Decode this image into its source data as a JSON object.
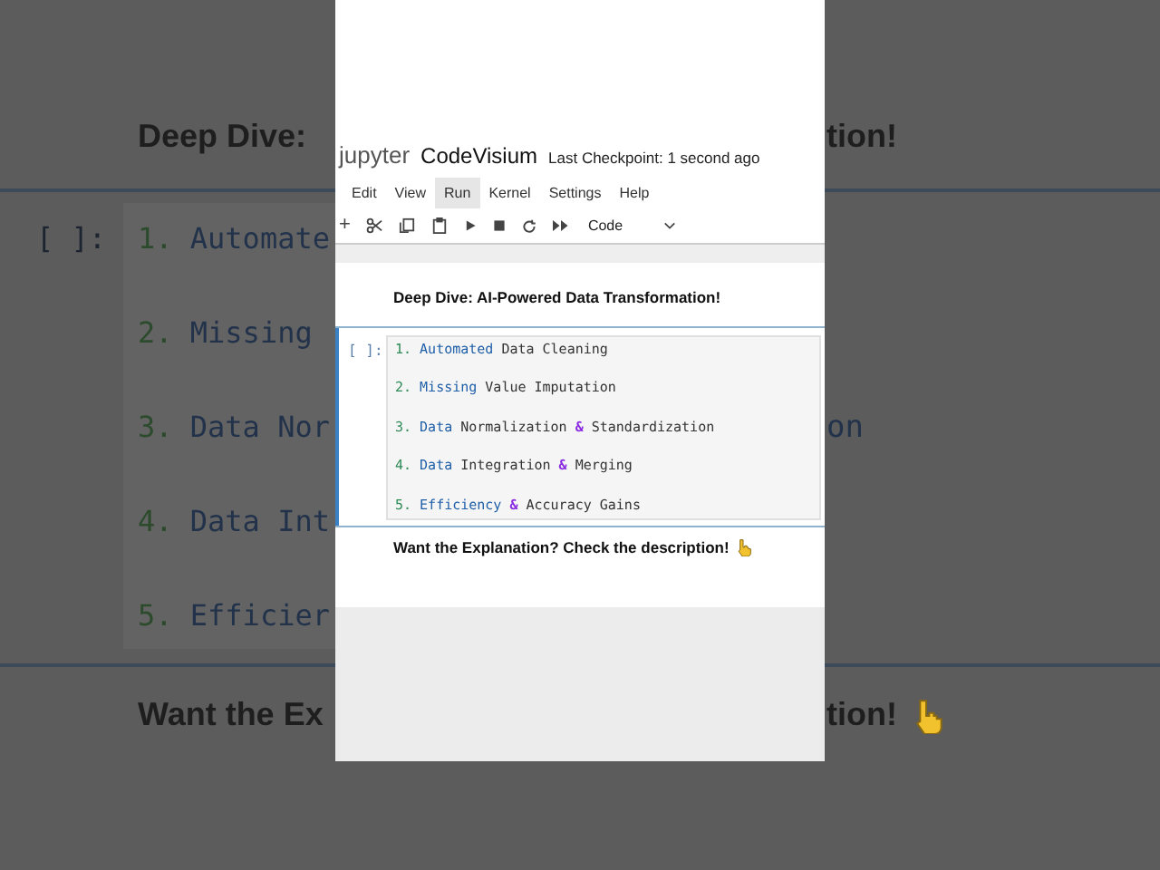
{
  "backdrop": {
    "left": [
      {
        "kind": "heading",
        "text": "Deep Dive: "
      },
      {
        "kind": "prompt",
        "text": "[ ]:"
      },
      {
        "kind": "code",
        "number": "1.",
        "text": "Automate"
      },
      {
        "kind": "code",
        "number": "2.",
        "text": "Missing"
      },
      {
        "kind": "code",
        "number": "3.",
        "text": "Data Nor"
      },
      {
        "kind": "code",
        "number": "4.",
        "text": "Data Int"
      },
      {
        "kind": "code",
        "number": "5.",
        "text": "Efficier"
      },
      {
        "kind": "footer",
        "text": "Want the Ex"
      }
    ],
    "right": [
      {
        "kind": "heading",
        "text": "tion!"
      },
      {
        "kind": "code",
        "text": "on"
      },
      {
        "kind": "footer",
        "text": "tion!"
      }
    ]
  },
  "header": {
    "logo": "jupyter",
    "notebook_name": "CodeVisium",
    "checkpoint": "Last Checkpoint: 1 second ago"
  },
  "menu": [
    {
      "label": "Edit",
      "selected": false
    },
    {
      "label": "View",
      "selected": false
    },
    {
      "label": "Run",
      "selected": true
    },
    {
      "label": "Kernel",
      "selected": false
    },
    {
      "label": "Settings",
      "selected": false
    },
    {
      "label": "Help",
      "selected": false
    }
  ],
  "toolbar": {
    "add": "+",
    "cell_type": "Code"
  },
  "cells": [
    {
      "kind": "markdown",
      "text": "Deep Dive: AI-Powered Data Transformation!"
    },
    {
      "kind": "code",
      "prompt": "[ ]:",
      "lines": [
        [
          {
            "kind": "number",
            "text": "1."
          },
          {
            "kind": "name",
            "text": "Automated"
          },
          {
            "kind": "text",
            "text": "Data Cleaning"
          }
        ],
        [
          {
            "kind": "number",
            "text": "2."
          },
          {
            "kind": "name",
            "text": "Missing"
          },
          {
            "kind": "text",
            "text": "Value Imputation"
          }
        ],
        [
          {
            "kind": "number",
            "text": "3."
          },
          {
            "kind": "name",
            "text": "Data"
          },
          {
            "kind": "text",
            "text": "Normalization"
          },
          {
            "kind": "operator",
            "text": "&"
          },
          {
            "kind": "text",
            "text": "Standardization"
          }
        ],
        [
          {
            "kind": "number",
            "text": "4."
          },
          {
            "kind": "name",
            "text": "Data"
          },
          {
            "kind": "text",
            "text": "Integration"
          },
          {
            "kind": "operator",
            "text": "&"
          },
          {
            "kind": "text",
            "text": "Merging"
          }
        ],
        [
          {
            "kind": "number",
            "text": "5."
          },
          {
            "kind": "name",
            "text": "Efficiency"
          },
          {
            "kind": "operator",
            "text": "&"
          },
          {
            "kind": "text",
            "text": "Accuracy Gains"
          }
        ]
      ]
    },
    {
      "kind": "markdown_footer",
      "text": "Want the Explanation? Check the description!"
    }
  ]
}
